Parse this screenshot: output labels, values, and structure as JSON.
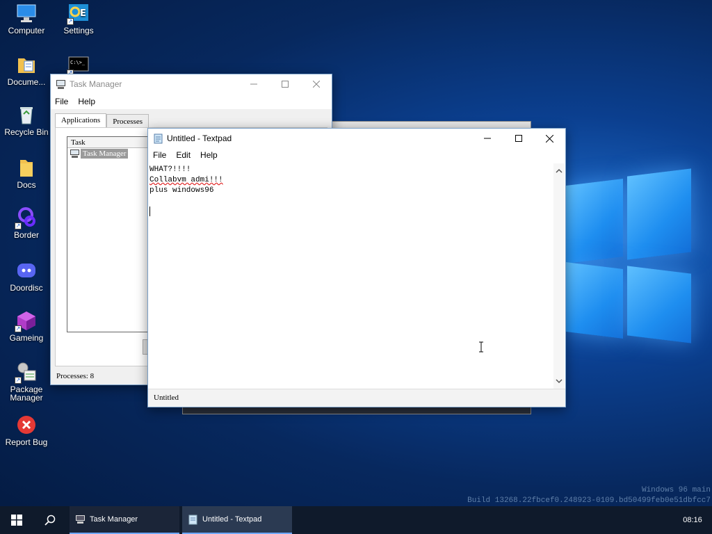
{
  "desktop": {
    "icons": [
      {
        "label": "Computer"
      },
      {
        "label": "Settings"
      },
      {
        "label": "Docume..."
      },
      {
        "label": "Recycle Bin"
      },
      {
        "label": "Docs"
      },
      {
        "label": "Border"
      },
      {
        "label": "Doordisc"
      },
      {
        "label": "Gameing"
      },
      {
        "label": "Package Manager"
      },
      {
        "label": "Report Bug"
      }
    ],
    "watermark_line1": "Windows 96 main",
    "watermark_line2": "Build 13268.22fbcef0.248923-0109.bd50499feb0e51dbfcc7",
    "cmd_prompt_text": "C:\\>_"
  },
  "task_manager": {
    "title": "Task Manager",
    "menu": [
      "File",
      "Help"
    ],
    "tabs": [
      "Applications",
      "Processes"
    ],
    "column_header": "Task",
    "rows": [
      "Task Manager"
    ],
    "status": "Processes: 8"
  },
  "textpad": {
    "title": "Untitled - Textpad",
    "menu": [
      "File",
      "Edit",
      "Help"
    ],
    "lines": [
      "WHAT?!!!!",
      "Collabvm admi!!!",
      "plus windows96"
    ],
    "status": "Untitled"
  },
  "taskbar": {
    "items": [
      "Task Manager",
      "Untitled - Textpad"
    ],
    "clock": "08:16"
  },
  "colors": {
    "taskbar": "#0f1a2b",
    "accent": "#6fa8ff"
  }
}
